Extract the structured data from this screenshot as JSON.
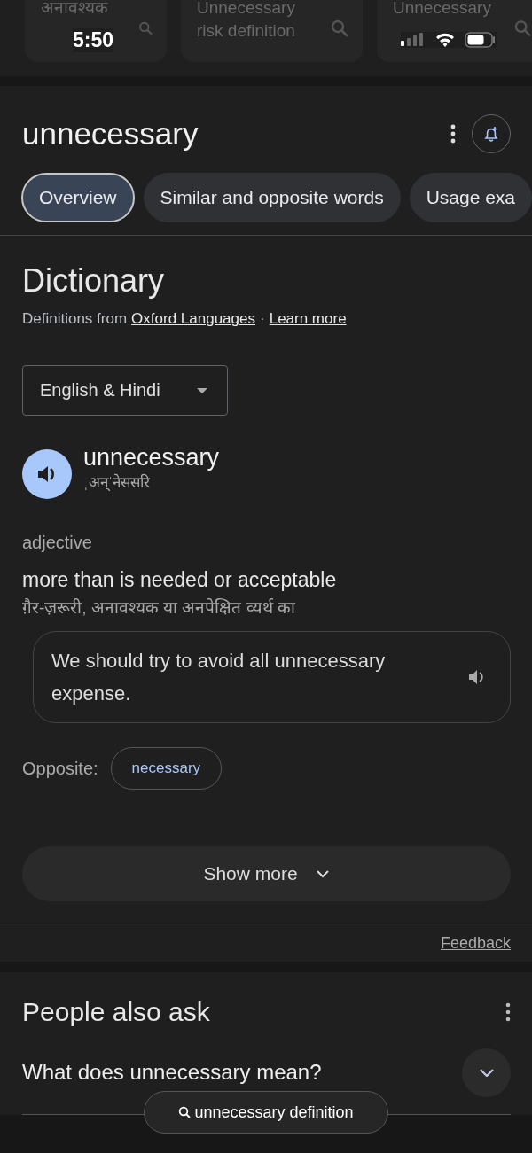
{
  "suggestions": [
    {
      "text": "अनावश्यक"
    },
    {
      "text": "Unnecessary risk definition"
    },
    {
      "text": "Unnecessary"
    }
  ],
  "status_bar": {
    "time": "5:50"
  },
  "header": {
    "title": "unnecessary"
  },
  "tabs": [
    {
      "label": "Overview",
      "selected": true
    },
    {
      "label": "Similar and opposite words",
      "selected": false
    },
    {
      "label": "Usage exa",
      "selected": false
    }
  ],
  "dictionary": {
    "title": "Dictionary",
    "source_prefix": "Definitions from",
    "source_link": "Oxford Languages",
    "separator": "·",
    "learn_more": "Learn more",
    "language": "English & Hindi",
    "word": "unnecessary",
    "pronunciation": "ˌअन्ˈनेससरि",
    "part_of_speech": "adjective",
    "definition": "more than is needed or acceptable",
    "translation": "ग़ैर-ज़रूरी, अनावश्यक या अनपेक्षित व्यर्थ का",
    "example": "We should try to avoid all unnecessary expense.",
    "opposite_label": "Opposite:",
    "opposites": [
      "necessary"
    ],
    "show_more": "Show more",
    "feedback": "Feedback"
  },
  "people_also_ask": {
    "title": "People also ask",
    "questions": [
      "What does unnecessary mean?"
    ]
  },
  "floating_search": {
    "text": "unnecessary definition"
  }
}
